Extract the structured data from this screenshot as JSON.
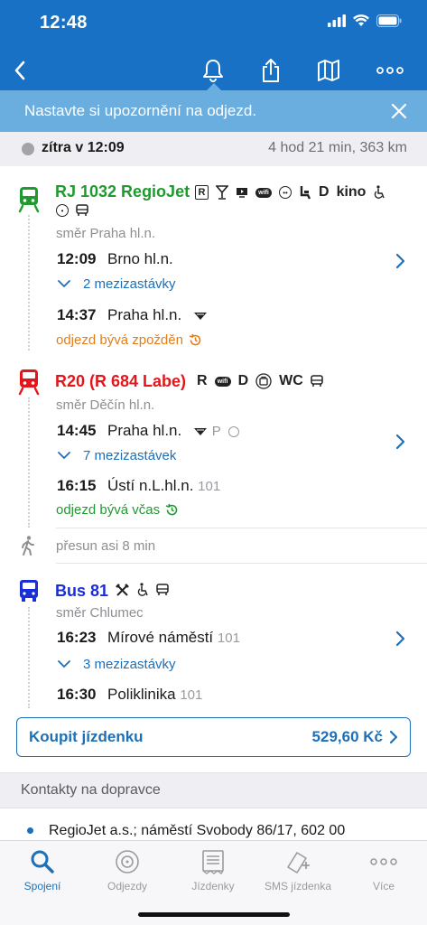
{
  "status": {
    "time": "12:48"
  },
  "banner": {
    "text": "Nastavte si upozornění na odjezd."
  },
  "summary": {
    "when": "zítra v 12:09",
    "duration": "4 hod 21 min, 363 km"
  },
  "legs": [
    {
      "name": "RJ 1032 RegioJet",
      "color": "#1f9a2f",
      "amenities": [
        "R",
        "bar-icon",
        "video-icon",
        "wifi-icon",
        "snack-icon",
        "wheelchair-seat-icon",
        "D",
        "kino",
        "wheelchair-icon",
        "power-icon",
        "bus-icon"
      ],
      "direction": "směr Praha hl.n.",
      "dep_time": "12:09",
      "dep_station": "Brno hl.n.",
      "intermediate": "2 mezizastávky",
      "arr_time": "14:37",
      "arr_station": "Praha hl.n.",
      "delay_text": "odjezd bývá zpožděn",
      "delay_color": "#e47d17"
    },
    {
      "name": "R20 (R 684 Labe)",
      "color": "#e3161b",
      "amenities": [
        "R",
        "wifi-icon",
        "D",
        "luggage-icon",
        "WC",
        "bus-icon"
      ],
      "direction": "směr Děčín hl.n.",
      "dep_time": "14:45",
      "dep_station": "Praha hl.n.",
      "dep_extra": "P",
      "intermediate": "7 mezizastávek",
      "arr_time": "16:15",
      "arr_station": "Ústí n.L.hl.n.",
      "arr_platform": "101",
      "delay_text": "odjezd bývá včas",
      "delay_color": "#1f9a2f"
    },
    {
      "name": "Bus 81",
      "color": "#1a2ed6",
      "amenities": [
        "tools-icon",
        "wheelchair-icon",
        "bus-icon"
      ],
      "direction": "směr Chlumec",
      "dep_time": "16:23",
      "dep_station": "Mírové náměstí",
      "dep_platform": "101",
      "intermediate": "3 mezizastávky",
      "arr_time": "16:30",
      "arr_station": "Poliklinika",
      "arr_platform": "101"
    }
  ],
  "walk": {
    "text": "přesun asi 8 min"
  },
  "buy": {
    "label": "Koupit jízdenku",
    "price": "529,60 Kč"
  },
  "contacts": {
    "header": "Kontakty na dopravce",
    "items": [
      "RegioJet a.s.; náměstí Svobody 86/17, 602 00"
    ]
  },
  "tabs": [
    {
      "label": "Spojení",
      "icon": "search-icon",
      "active": true
    },
    {
      "label": "Odjezdy",
      "icon": "departures-icon",
      "active": false
    },
    {
      "label": "Jízdenky",
      "icon": "tickets-icon",
      "active": false
    },
    {
      "label": "SMS jízdenka",
      "icon": "sms-ticket-icon",
      "active": false
    },
    {
      "label": "Více",
      "icon": "more-icon",
      "active": false
    }
  ],
  "colors": {
    "brand": "#1871c4",
    "banner": "#6aaee0",
    "link": "#1d6fb8"
  }
}
